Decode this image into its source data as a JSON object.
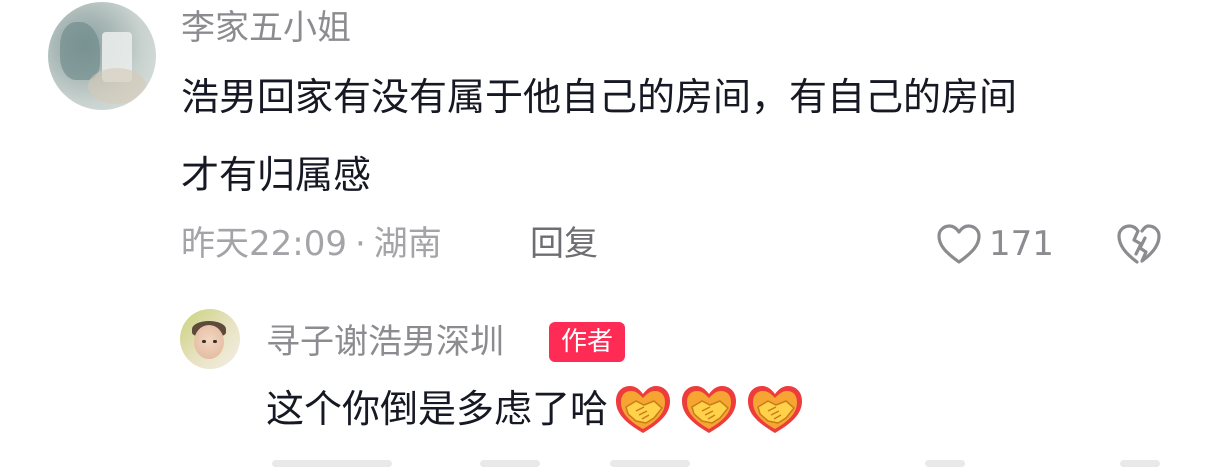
{
  "comment": {
    "username": "李家五小姐",
    "text_line1": "浩男回家有没有属于他自己的房间，有自己的房间",
    "text_line2": "才有归属感",
    "time": "昨天22:09",
    "separator": "·",
    "location": "湖南",
    "reply_label": "回复",
    "like_count": "171",
    "like_icon": "heart-outline-icon",
    "dislike_icon": "broken-heart-icon"
  },
  "reply": {
    "username": "寻子谢浩男深圳",
    "badge": "作者",
    "text": "这个你倒是多虑了哈",
    "emoji_count": 3,
    "emoji_icon": "handshake-emoji-icon"
  },
  "colors": {
    "badge": "#fe2c55",
    "username": "#8c8c90",
    "text": "#161823",
    "meta": "#a4a4a8"
  }
}
